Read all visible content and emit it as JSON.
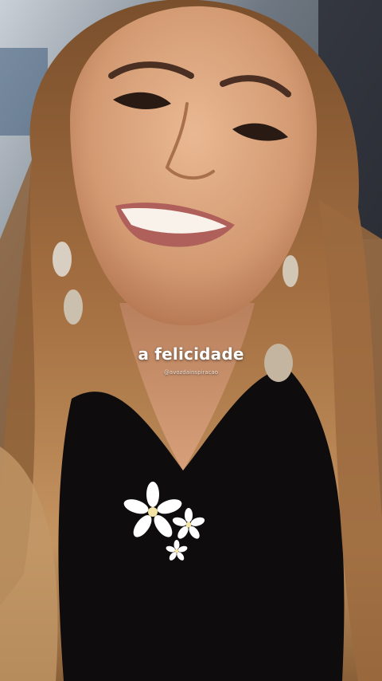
{
  "story": {
    "caption": "a felicidade",
    "handle": "@avozdainspiracao"
  },
  "sticker": {
    "icon": "white-flowers-icon",
    "petal_color": "#ffffff",
    "center_color": "#f3e3a4"
  },
  "colors": {
    "hair": "#a06c3c",
    "shirt": "#0e0c0c",
    "skin": "#d9a57f"
  }
}
